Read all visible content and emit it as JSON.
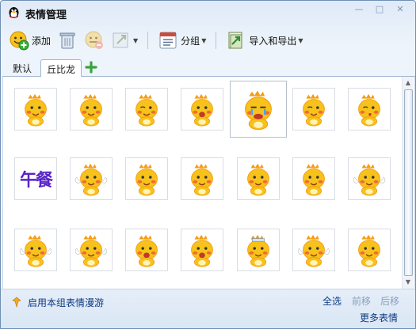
{
  "window": {
    "title": "表情管理",
    "icon": "penguin-icon"
  },
  "toolbar": {
    "add_label": "添加",
    "group_label": "分组",
    "import_export_label": "导入和导出"
  },
  "tabs": [
    {
      "label": "默认",
      "active": false
    },
    {
      "label": "丘比龙",
      "active": true
    }
  ],
  "grid": {
    "rows": 3,
    "cols": 7,
    "selected_index": 4,
    "special_text_cell": {
      "index": 7,
      "text": "午餐"
    }
  },
  "footer": {
    "roam_label": "启用本组表情漫游",
    "select_all": "全选",
    "move_forward": "前移",
    "move_backward": "后移",
    "more": "更多表情"
  },
  "colors": {
    "accent": "#0d3a82",
    "disabled": "#8aa0bb",
    "dino_body": "#f7c21b",
    "dino_shade": "#f59d12",
    "blush": "#f05a3c"
  }
}
